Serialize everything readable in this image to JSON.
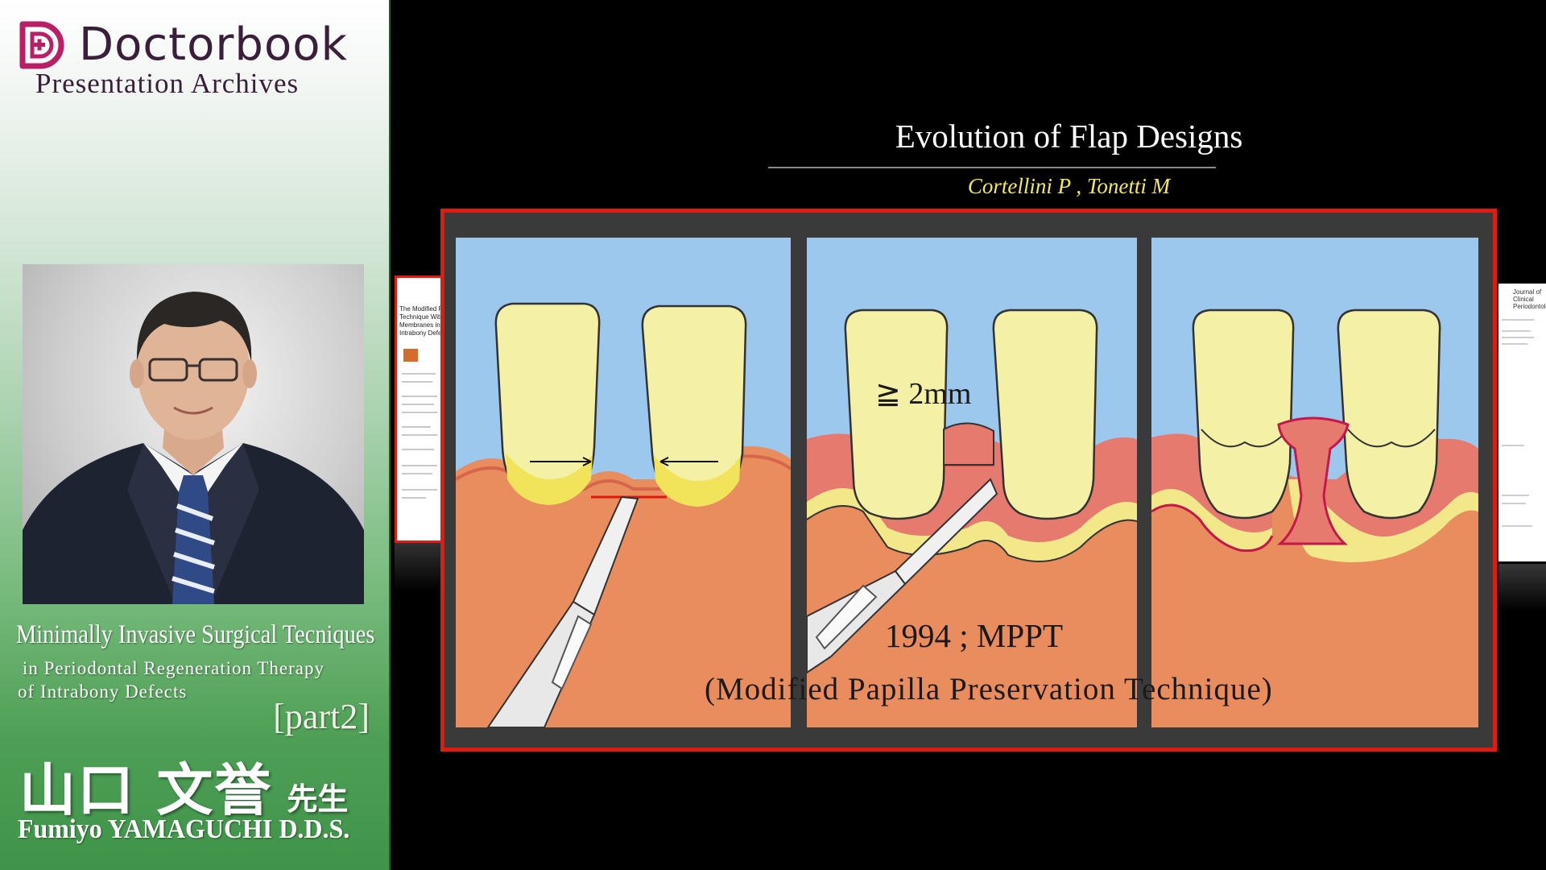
{
  "brand": {
    "name": "Doctorbook",
    "subtitle": "Presentation Archives",
    "accent_color": "#b81f67"
  },
  "talk": {
    "title": "Minimally Invasive Surgical Tecniques",
    "subtitle_line1": "in Periodontal Regeneration Therapy",
    "subtitle_line2": "of Intrabony Defects",
    "part": "[part2]"
  },
  "speaker": {
    "name_jp": "山口 文誉",
    "honorific": "先生",
    "name_en": "Fumiyo YAMAGUCHI D.D.S."
  },
  "slide": {
    "title": "Evolution of Flap Designs",
    "authors": "Cortellini P , Tonetti M",
    "measurement": "≧ 2mm",
    "year_label": "1994 ; MPPT",
    "technique": "(Modified Papilla Preservation Technique)",
    "frame_color": "#e01b12",
    "authors_color": "#f2ea5c",
    "left_doc_text": "The Modified Papilla Technique With Membranes in Intrabony Defects",
    "right_doc_text": "Journal of Clinical Periodontology"
  },
  "icons": {
    "logo": "doctorbook-logo-icon",
    "scalpel": "scalpel-illustration"
  }
}
